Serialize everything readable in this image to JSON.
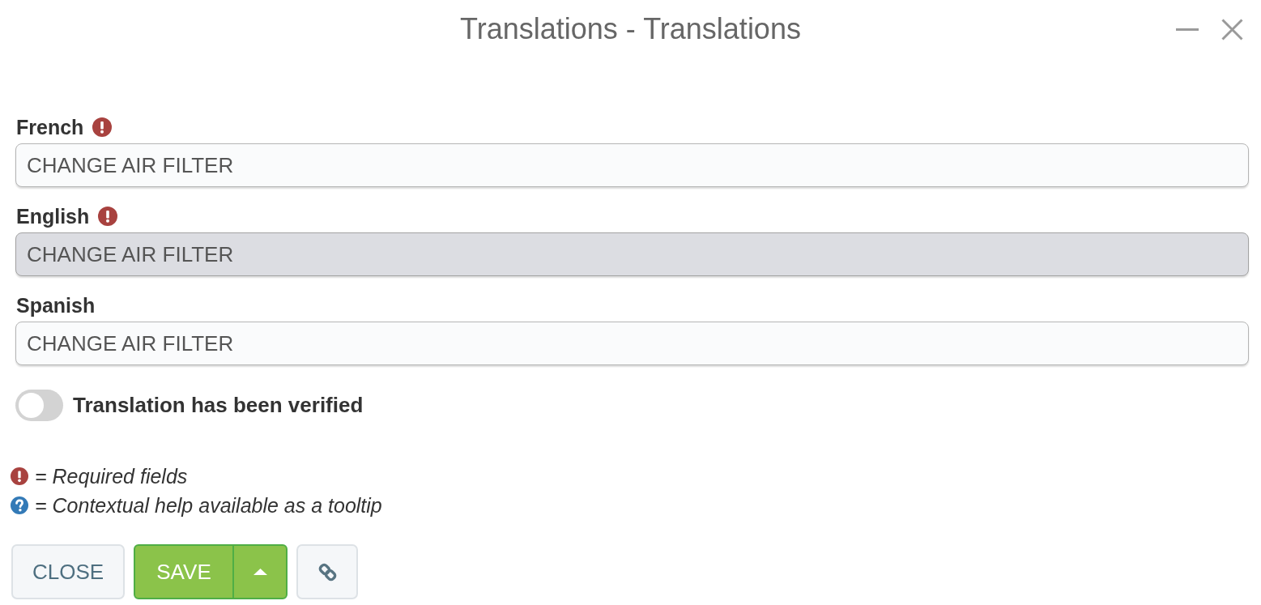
{
  "window": {
    "title": "Translations - Translations"
  },
  "fields": [
    {
      "label": "French",
      "required": true,
      "value": "CHANGE AIR FILTER",
      "disabled": false
    },
    {
      "label": "English",
      "required": true,
      "value": "CHANGE AIR FILTER",
      "disabled": true
    },
    {
      "label": "Spanish",
      "required": false,
      "value": "CHANGE AIR FILTER",
      "disabled": false
    }
  ],
  "verified": {
    "label": "Translation has been verified",
    "on": false
  },
  "legend": [
    {
      "kind": "required",
      "text": "= Required fields"
    },
    {
      "kind": "help",
      "text": "= Contextual help available as a tooltip"
    }
  ],
  "buttons": {
    "close": "CLOSE",
    "save": "SAVE"
  }
}
